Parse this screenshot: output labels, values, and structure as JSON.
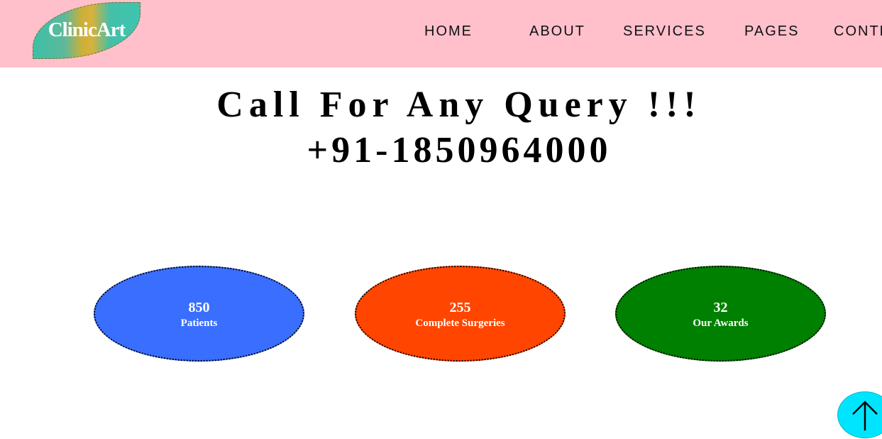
{
  "header": {
    "logo_text": "ClinicArt",
    "nav": [
      {
        "label": "HOME"
      },
      {
        "label": "ABOUT"
      },
      {
        "label": "SERVICES"
      },
      {
        "label": "PAGES"
      },
      {
        "label": "CONTE"
      }
    ],
    "background_color": "#ffc0cb"
  },
  "hero": {
    "line1": "Call For Any Query !!!",
    "line2": "+91-1850964000"
  },
  "stats": [
    {
      "value": "850",
      "label": "Patients",
      "color": "#3a6eff"
    },
    {
      "value": "255",
      "label": "Complete Surgeries",
      "color": "#ff4500"
    },
    {
      "value": "32",
      "label": "Our Awards",
      "color": "#008000"
    }
  ],
  "scroll_top": {
    "icon": "arrow-up-icon",
    "color": "#00e5ff"
  }
}
